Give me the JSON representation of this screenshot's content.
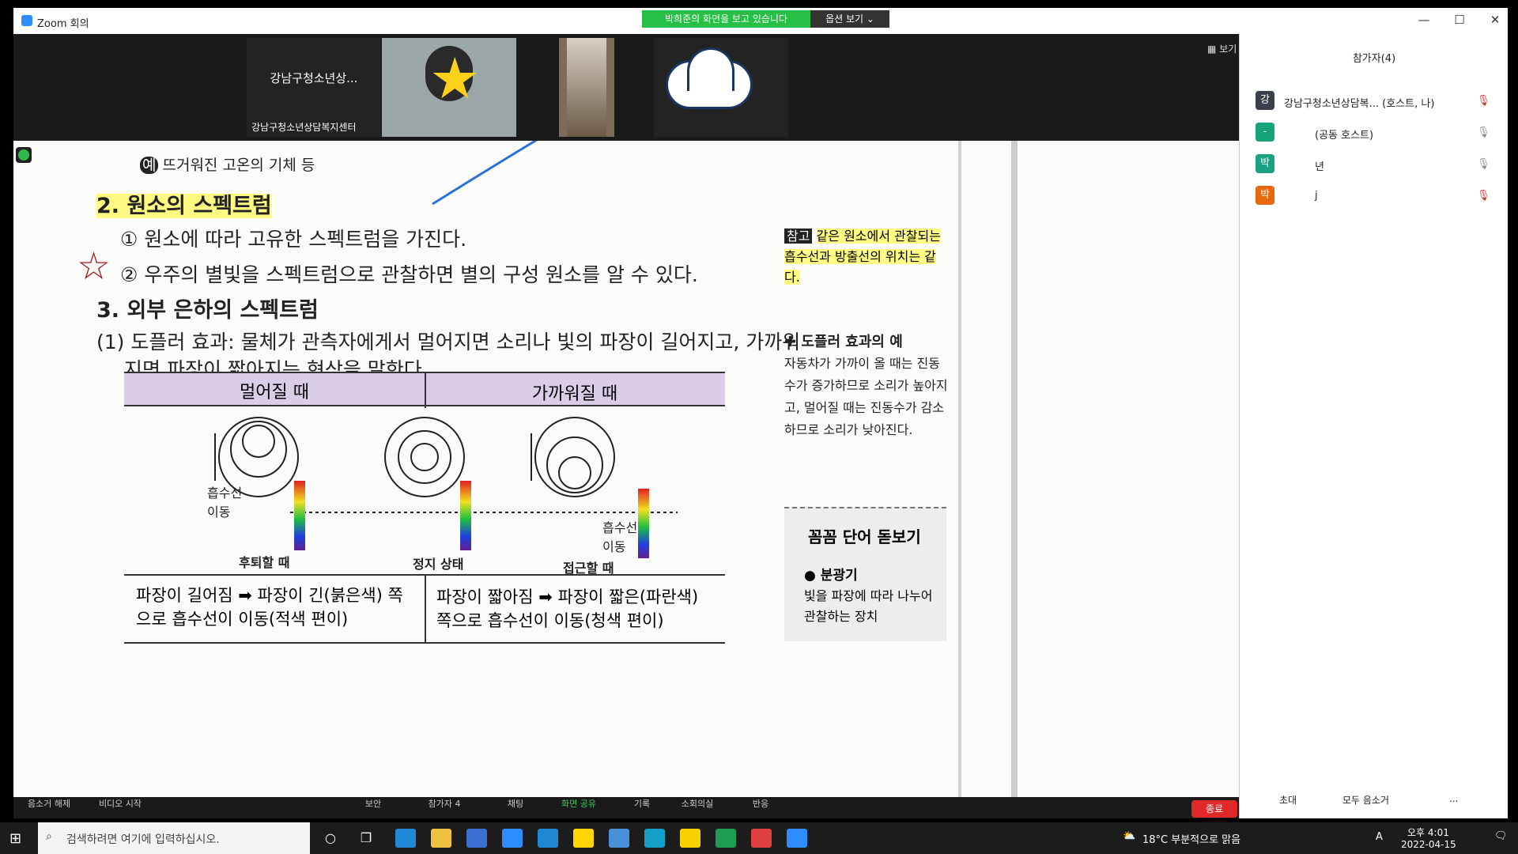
{
  "window": {
    "title": "Zoom 회의",
    "share_banner": "박희준의 화면을 보고 있습니다",
    "view_options": "옵션 보기 ⌄",
    "view_btn": "▦ 보기"
  },
  "tiles": [
    {
      "title": "강남구청소년상...",
      "name": "강남구청소년상담복지센터"
    },
    {
      "title": "",
      "name": ""
    },
    {
      "title": "",
      "name": ""
    },
    {
      "title": "",
      "name": ""
    }
  ],
  "participants": {
    "header": "참가자(4)",
    "list": [
      {
        "avatar": "강",
        "color": "#3a3f4a",
        "name": "강남구청소년상담복... (호스트, 나)"
      },
      {
        "avatar": "-",
        "color": "#15a37a",
        "name": "(공동 호스트)"
      },
      {
        "avatar": "박",
        "color": "#1aa17f",
        "name": "년"
      },
      {
        "avatar": "박",
        "color": "#e6680f",
        "name": "j"
      }
    ],
    "footer": {
      "invite": "초대",
      "mute_all": "모두 음소거",
      "more": "..."
    }
  },
  "doc": {
    "ex": "뜨거워진 고온의 기체 등",
    "h2": "2. 원소의 스펙트럼",
    "l1": "① 원소에 따라 고유한 스펙트럼을 가진다.",
    "l2": "② 우주의 별빛을 스펙트럼으로 관찰하면 별의 구성 원소를 알 수 있다.",
    "h3": "3. 외부 은하의 스펙트럼",
    "p1a": "(1) 도플러 효과: 물체가 관측자에게서 멀어지면 소리나 빛의 파장이 길어지고, 가까워",
    "p1b": "지면 파장이 짧아지는 현상을 말한다.",
    "col1": "멀어질 때",
    "col2": "가까워질 때",
    "cap1": "후퇴할 때",
    "cap2": "정지 상태",
    "cap3": "접근할 때",
    "abs1": "흡수선 이동",
    "abs2": "흡수선 이동",
    "b1": "파장이 길어짐 ➡ 파장이 긴(붉은색) 쪽으로 흡수선이 이동(적색 편이)",
    "b2": "파장이 짧아짐 ➡ 파장이 짧은(파란색) 쪽으로 흡수선이 이동(청색 편이)",
    "ref_tag": "참고",
    "ref": "같은 원소에서 관찰되는 흡수선과 방출선의 위치는 같다.",
    "dop_h": "✚ 도플러 효과의 예",
    "dop": "자동차가 가까이 올 때는 진동수가 증가하므로 소리가 높아지고, 멀어질 때는 진동수가 감소하므로 소리가 낮아진다.",
    "vocab_h": "꼼꼼 단어 돋보기",
    "vocab_w": "● 분광기",
    "vocab_d": "빛을 파장에 따라 나누어 관찰하는 장치"
  },
  "controls": [
    "음소거 해제",
    "비디오 시작",
    "보안",
    "참가자",
    "채팅",
    "화면 공유",
    "기록",
    "소회의실",
    "반응"
  ],
  "participant_count": "4",
  "end_label": "종료",
  "taskbar": {
    "search_placeholder": "검색하려면 여기에 입력하십시오.",
    "weather": "18°C 부분적으로 맑음",
    "time": "오후 4:01",
    "date": "2022-04-15",
    "ime": "A"
  }
}
